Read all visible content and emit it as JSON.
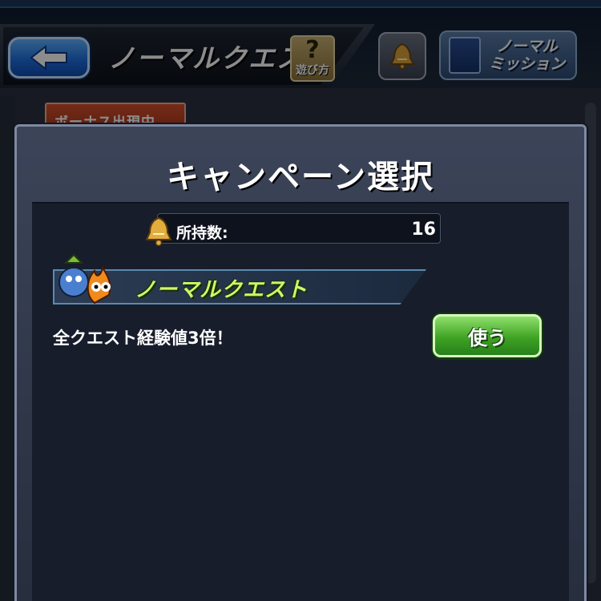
{
  "header": {
    "title": "ノーマルクエスト",
    "help_label": "遊び方",
    "help_glyph": "?",
    "mission_label_line1": "ノーマル",
    "mission_label_line2": "ミッション"
  },
  "background": {
    "bonus_tag": "ボーナス出現中"
  },
  "modal": {
    "title": "キャンペーン選択",
    "owned_label": "所持数:",
    "owned_count": "16",
    "campaign": {
      "name": "ノーマルクエスト",
      "description": "全クエスト経験値3倍！",
      "use_label": "使う"
    }
  },
  "colors": {
    "accent_green": "#3fa324",
    "back_blue": "#1f6fe0",
    "banner_text": "#cff56a"
  }
}
